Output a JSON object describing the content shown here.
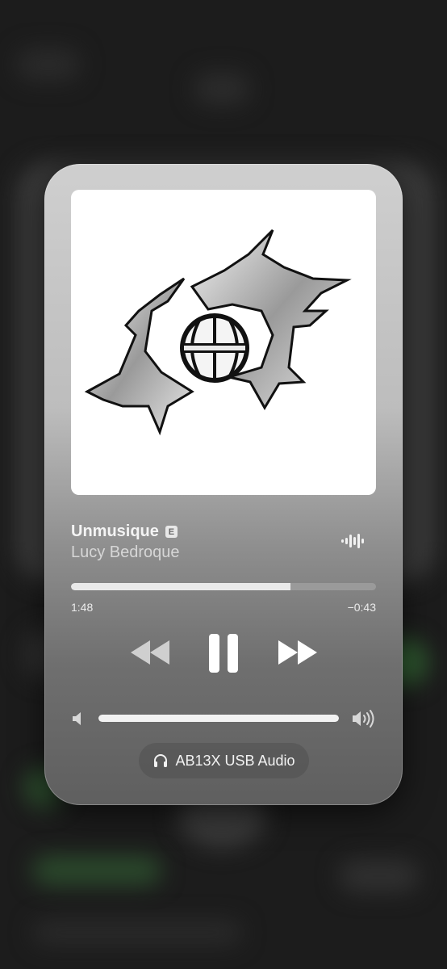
{
  "now_playing": {
    "title": "Unmusique",
    "explicit_badge": "E",
    "artist": "Lucy Bedroque",
    "progress_fraction": 0.72,
    "time_elapsed": "1:48",
    "time_remaining": "−0:43",
    "volume_fraction": 1.0,
    "output_device": "AB13X USB Audio"
  },
  "icons": {
    "artwork": "gothic-letter-logo-with-basketball",
    "waveform": "waveform-icon",
    "rewind": "backward-icon",
    "pause": "pause-icon",
    "forward": "forward-icon",
    "volume_low": "speaker-icon",
    "volume_high": "speaker-wave-icon",
    "headphones": "headphones-icon"
  },
  "colors": {
    "card_top": "#cfcfcf",
    "card_bottom": "#5f5f5f",
    "text_primary": "#f4f4f4",
    "progress_fill": "#e9e9e9"
  }
}
